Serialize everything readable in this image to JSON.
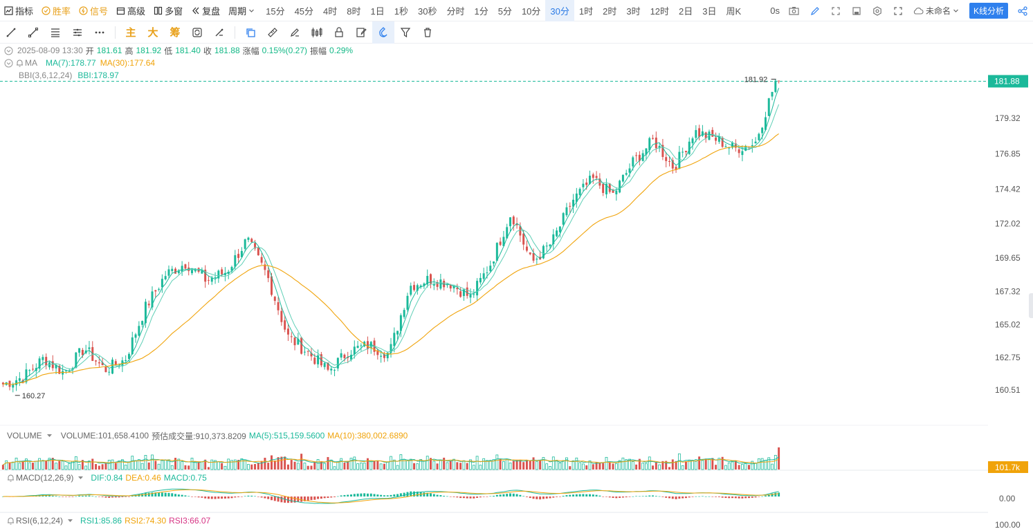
{
  "toolbar": {
    "indicators": "指标",
    "win_rate": "胜率",
    "signal": "信号",
    "advanced": "高级",
    "multi_window": "多窗",
    "replay": "复盘",
    "period_label": "周期",
    "periods": [
      "15分",
      "45分",
      "4时",
      "8时",
      "1日",
      "1秒",
      "30秒",
      "分时",
      "1分",
      "5分",
      "10分",
      "30分",
      "1时",
      "2时",
      "3时",
      "12时",
      "2日",
      "3日",
      "周K"
    ],
    "active_period": "30分",
    "countdown": "0s",
    "unnamed": "未命名",
    "kline_analysis": "K线分析"
  },
  "draw_tools": {
    "text_tools": [
      "主",
      "大",
      "筹"
    ]
  },
  "info": {
    "date": "2025-08-09 13:30",
    "open_label": "开",
    "open": "181.61",
    "high_label": "高",
    "high": "181.92",
    "low_label": "低",
    "low": "181.40",
    "close_label": "收",
    "close": "181.88",
    "change_label": "涨幅",
    "change": "0.15%(0.27)",
    "amp_label": "振幅",
    "amp": "0.29%"
  },
  "ma_line": {
    "name": "MA",
    "ma7": "MA(7):178.77",
    "ma30": "MA(30):177.64"
  },
  "bbi_line": {
    "name": "BBI(3,6,12,24)",
    "value": "BBI:178.97"
  },
  "volume_line": {
    "name": "VOLUME",
    "volume": "VOLUME:101,658.4100",
    "estimate": "预估成交量:910,373.8209",
    "ma5": "MA(5):515,159.5600",
    "ma10": "MA(10):380,002.6890"
  },
  "macd_line": {
    "name": "MACD(12,26,9)",
    "dif": "DIF:0.84",
    "dea": "DEA:0.46",
    "macd": "MACD:0.75"
  },
  "rsi_line": {
    "name": "RSI(6,12,24)",
    "rsi1": "RSI1:85.86",
    "rsi2": "RSI2:74.30",
    "rsi3": "RSI3:66.07"
  },
  "colors": {
    "up": "#1bb99a",
    "down": "#d9534f",
    "ma7": "#1bb99a",
    "ma30": "#f0a30a",
    "accent": "#2f80ed"
  },
  "chart_data": {
    "type": "candlestick",
    "price_axis_ticks": [
      179.32,
      176.85,
      174.42,
      172.02,
      169.65,
      167.32,
      165.02,
      162.75,
      160.51
    ],
    "price_range": [
      159.2,
      182.3
    ],
    "last_price_label": "181.88",
    "high_marker_label": "181.92",
    "low_marker_label": "160.27",
    "volume_last_label": "101.7k",
    "macd_axis_label": "0.00",
    "rsi_axis_label": "100.00",
    "trend_path": [
      160.9,
      161.4,
      162.7,
      161.7,
      163.4,
      161.9,
      162.6,
      166.2,
      168.5,
      169.3,
      168.1,
      168.7,
      170.9,
      168.4,
      164.2,
      163.1,
      161.8,
      163.2,
      163.6,
      163.0,
      167.7,
      168.2,
      167.9,
      166.9,
      169.3,
      172.8,
      169.3,
      170.7,
      173.6,
      175.1,
      174.0,
      176.3,
      177.8,
      175.9,
      178.4,
      177.9,
      177.2,
      177.6,
      181.88
    ]
  }
}
